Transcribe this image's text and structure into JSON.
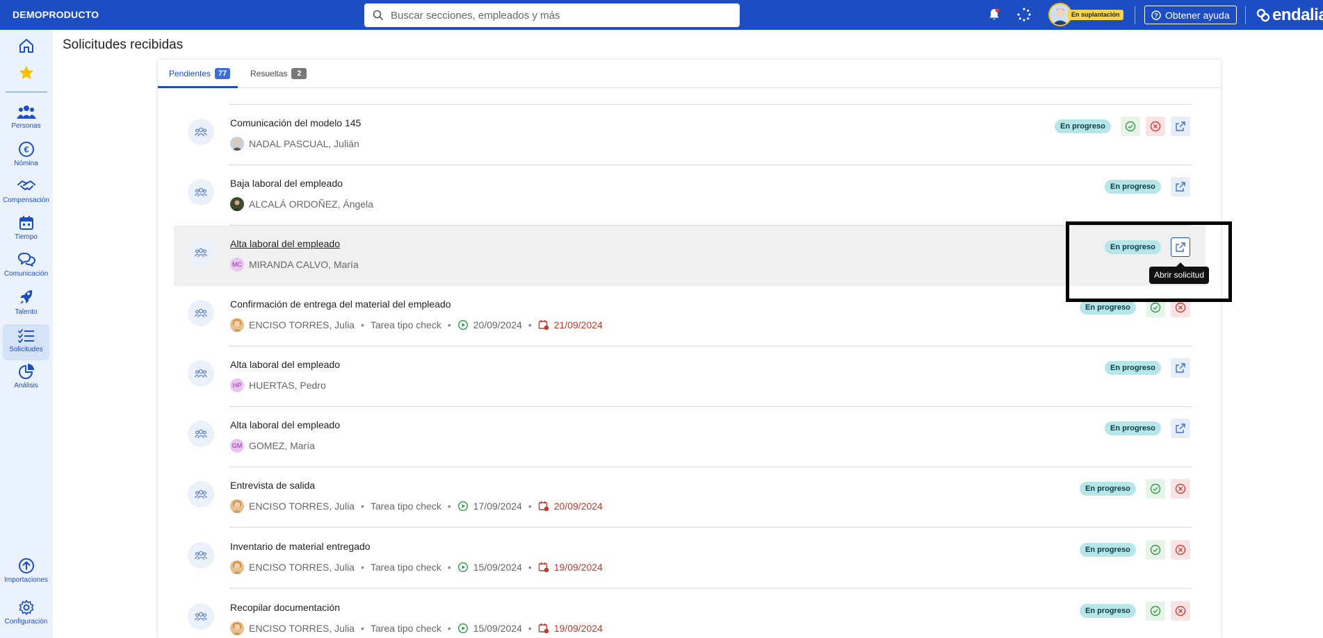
{
  "topbar": {
    "brand": "DEMOPRODUCTO",
    "search_placeholder": "Buscar secciones, empleados y más",
    "impersonation_label": "En suplantación",
    "help_label": "Obtener ayuda",
    "logo_text": "endalia"
  },
  "sidebar": {
    "items": [
      {
        "label": "Personas"
      },
      {
        "label": "Nómina"
      },
      {
        "label": "Compensación"
      },
      {
        "label": "Tiempo"
      },
      {
        "label": "Comunicación"
      },
      {
        "label": "Talento"
      },
      {
        "label": "Solicitudes"
      },
      {
        "label": "Análisis"
      },
      {
        "label": "Importaciones"
      },
      {
        "label": "Configuración"
      }
    ]
  },
  "page": {
    "title": "Solicitudes recibidas"
  },
  "tabs": [
    {
      "label": "Pendientes",
      "count": "77"
    },
    {
      "label": "Resueltas",
      "count": "2"
    }
  ],
  "requests": [
    {
      "title": "Comunicación del modelo 145",
      "person": "NADAL PASCUAL, Julián",
      "status": "En progreso"
    },
    {
      "title": "Baja laboral del empleado",
      "person": "ALCALÁ ORDOÑEZ, Ángela",
      "status": "En progreso"
    },
    {
      "title": "Alta laboral del empleado",
      "person": "MIRANDA CALVO, María",
      "initials": "MC",
      "status": "En progreso"
    },
    {
      "title": "Confirmación de entrega del material del empleado",
      "person": "ENCISO TORRES, Julia",
      "task_type": "Tarea tipo check",
      "start_date": "20/09/2024",
      "due_date": "21/09/2024",
      "status": "En progreso"
    },
    {
      "title": "Alta laboral del empleado",
      "person": "HUERTAS, Pedro",
      "initials": "HP",
      "status": "En progreso"
    },
    {
      "title": "Alta laboral del empleado",
      "person": "GOMEZ, María",
      "initials": "GM",
      "status": "En progreso"
    },
    {
      "title": "Entrevista de salida",
      "person": "ENCISO TORRES, Julia",
      "task_type": "Tarea tipo check",
      "start_date": "17/09/2024",
      "due_date": "20/09/2024",
      "status": "En progreso"
    },
    {
      "title": "Inventario de material entregado",
      "person": "ENCISO TORRES, Julia",
      "task_type": "Tarea tipo check",
      "start_date": "15/09/2024",
      "due_date": "19/09/2024",
      "status": "En progreso"
    },
    {
      "title": "Recopilar documentación",
      "person": "ENCISO TORRES, Julia",
      "task_type": "Tarea tipo check",
      "start_date": "15/09/2024",
      "due_date": "19/09/2024",
      "status": "En progreso"
    }
  ],
  "tooltip": {
    "text": "Abrir solicitud"
  },
  "colors": {
    "primary": "#1c4dc2",
    "status_bg": "#b6e6ea",
    "due_red": "#c0392b",
    "sidebar_bg": "#eaf2fd"
  }
}
